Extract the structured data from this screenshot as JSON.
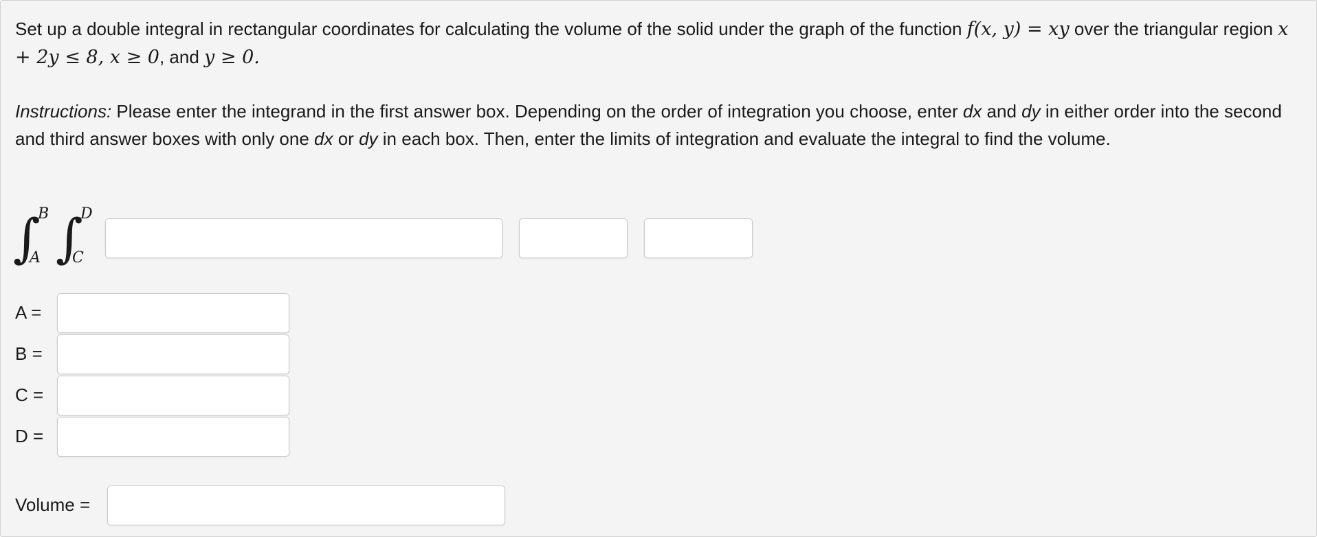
{
  "question": {
    "prefix": "Set up a double integral in rectangular coordinates for calculating the volume of the solid under the graph of the function ",
    "function_expr": "f(x, y) = xy",
    "middle": " over the triangular region ",
    "cond1": "x + 2y ≤ 8",
    "sep1": ", ",
    "cond2": "x ≥ 0",
    "sep2": ", and ",
    "cond3": "y ≥ 0",
    "end": "."
  },
  "instructions": {
    "label": "Instructions:",
    "text1": " Please enter the integrand in the first answer box. Depending on the order of integration you choose, enter ",
    "dx": "dx",
    "and": " and ",
    "dy": "dy",
    "text2": " in either order into the second and third answer boxes with only one ",
    "dx2": "dx",
    "or": " or ",
    "dy2": "dy",
    "text3": " in each box. Then, enter the limits of integration and evaluate the integral to find the volume."
  },
  "integral": {
    "outer_upper": "B",
    "outer_lower": "A",
    "inner_upper": "D",
    "inner_lower": "C",
    "sign": "∫"
  },
  "answers": {
    "integrand_value": "",
    "diff1_value": "",
    "diff2_value": "",
    "a_label": "A =",
    "a_value": "",
    "b_label": "B =",
    "b_value": "",
    "c_label": "C =",
    "c_value": "",
    "d_label": "D =",
    "d_value": "",
    "volume_label": "Volume =",
    "volume_value": ""
  },
  "colors": {
    "panel_bg": "#f4f4f4",
    "panel_border": "#d2d2d2",
    "text": "#1a1a1a",
    "input_border": "#c9c9c9"
  }
}
